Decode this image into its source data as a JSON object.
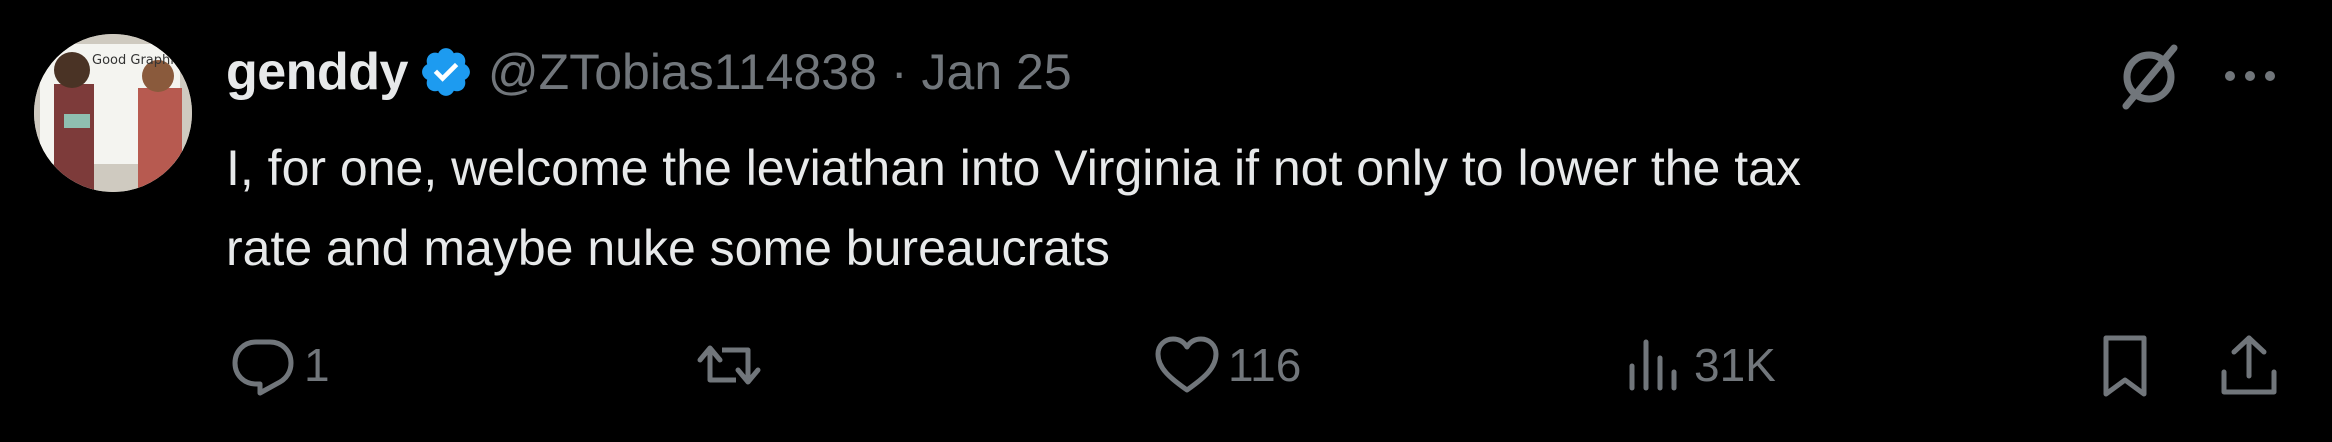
{
  "author": {
    "display_name": "genddy",
    "handle": "@ZTobias114838",
    "separator": "·",
    "date": "Jan 25",
    "avatar_text": "Good Graphics!"
  },
  "tweet": {
    "text": "I, for one, welcome the leviathan into Virginia if not only to lower the tax\nrate and maybe nuke some bureaucrats"
  },
  "metrics": {
    "replies": "1",
    "retweets": "",
    "likes": "116",
    "views": "31K"
  },
  "icons": {
    "verified": "verified-badge-icon",
    "grok": "grok-icon",
    "more": "more-icon",
    "reply": "reply-icon",
    "retweet": "retweet-icon",
    "like": "heart-icon",
    "views": "views-icon",
    "bookmark": "bookmark-icon",
    "share": "share-icon"
  },
  "colors": {
    "background": "#000000",
    "text": "#e7e9ea",
    "muted": "#71767b",
    "verified_blue": "#1d9bf0"
  }
}
